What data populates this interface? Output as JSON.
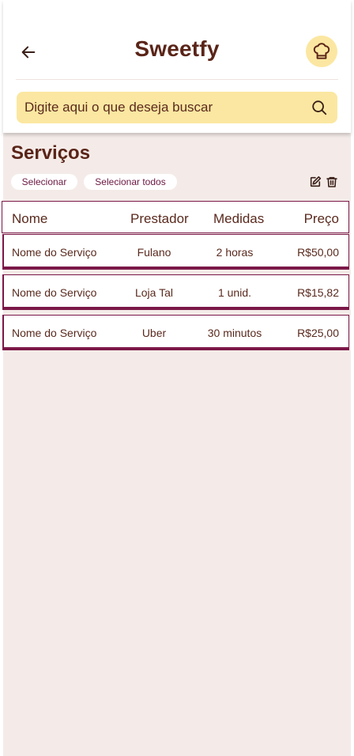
{
  "header": {
    "title": "Sweetfy",
    "back_icon": "arrow-left-icon",
    "profile_icon": "chef-hat-icon"
  },
  "search": {
    "placeholder": "Digite aqui o que deseja buscar",
    "icon": "search-icon"
  },
  "section": {
    "title": "Serviços",
    "select_label": "Selecionar",
    "select_all_label": "Selecionar todos",
    "edit_icon": "edit-icon",
    "delete_icon": "trash-icon"
  },
  "table": {
    "columns": [
      "Nome",
      "Prestador",
      "Medidas",
      "Preço"
    ],
    "rows": [
      {
        "nome": "Nome do Serviço",
        "prestador": "Fulano",
        "medidas": "2 horas",
        "preco": "R$50,00"
      },
      {
        "nome": "Nome do Serviço",
        "prestador": "Loja Tal",
        "medidas": "1 unid.",
        "preco": "R$15,82"
      },
      {
        "nome": "Nome do Serviço",
        "prestador": "Uber",
        "medidas": "30 minutos",
        "preco": "R$25,00"
      }
    ]
  },
  "colors": {
    "brand_brown": "#5a2418",
    "accent_yellow": "#fbe7a1",
    "row_border": "#7b1848",
    "background": "#f4ebe8"
  }
}
